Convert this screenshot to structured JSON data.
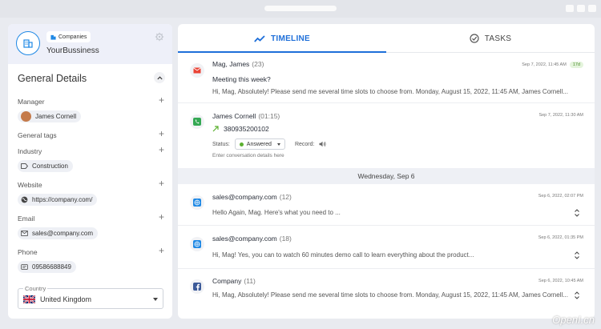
{
  "company": {
    "badge": "Companies",
    "name": "YourBussiness"
  },
  "general": {
    "title": "General Details",
    "manager": {
      "label": "Manager",
      "value": "James Cornell"
    },
    "tags": {
      "label": "General tags"
    },
    "industry": {
      "label": "Industry",
      "value": "Construction"
    },
    "website": {
      "label": "Website",
      "value": "https://company.com/"
    },
    "email": {
      "label": "Email",
      "value": "sales@company.com"
    },
    "phone": {
      "label": "Phone",
      "value": "09586688849"
    },
    "country": {
      "label": "Country",
      "value": "United Kingdom"
    }
  },
  "tabs": {
    "timeline": "TIMELINE",
    "tasks": "TASKS"
  },
  "timeline": {
    "email_item": {
      "title": "Mag, James",
      "count": "(23)",
      "date": "Sep 7, 2022, 11:45 AM",
      "badge": "17d",
      "subject": "Meeting this week?",
      "message": "Hi, Mag, Absolutely! Please send me several time slots to choose from. Monday, August 15, 2022, 11:45 AM, James Cornell..."
    },
    "call_item": {
      "title": "James Cornell",
      "duration": "(01:15)",
      "date": "Sep 7, 2022, 11:30 AM",
      "phone": "380935200102",
      "status_label": "Status:",
      "status_value": "Answered",
      "record_label": "Record:",
      "placeholder": "Enter conversation details here"
    },
    "day_separator": "Wednesday, Sep 6",
    "chat1": {
      "title": "sales@company.com",
      "count": "(12)",
      "date": "Sep 6, 2022, 02:07 PM",
      "message": "Hello Again, Mag. Here's what you need to ..."
    },
    "chat2": {
      "title": "sales@company.com",
      "count": "(18)",
      "date": "Sep 6, 2022, 01:35 PM",
      "message": "Hi, Mag! Yes, you can to watch 60 minutes demo call to learn everything about the product..."
    },
    "chat3": {
      "title": "Company",
      "count": "(11)",
      "date": "Sep 6, 2022, 10:45 AM",
      "message": "Hi, Mag, Absolutely! Please send me several time slots to choose from. Monday, August 15, 2022, 11:45 AM, James Cornell..."
    }
  },
  "watermark": "OpenI.cn",
  "colors": {
    "accent": "#1e6fd9",
    "answered": "#5cb030",
    "gmail": "#ea4335",
    "facebook": "#3b5998"
  }
}
